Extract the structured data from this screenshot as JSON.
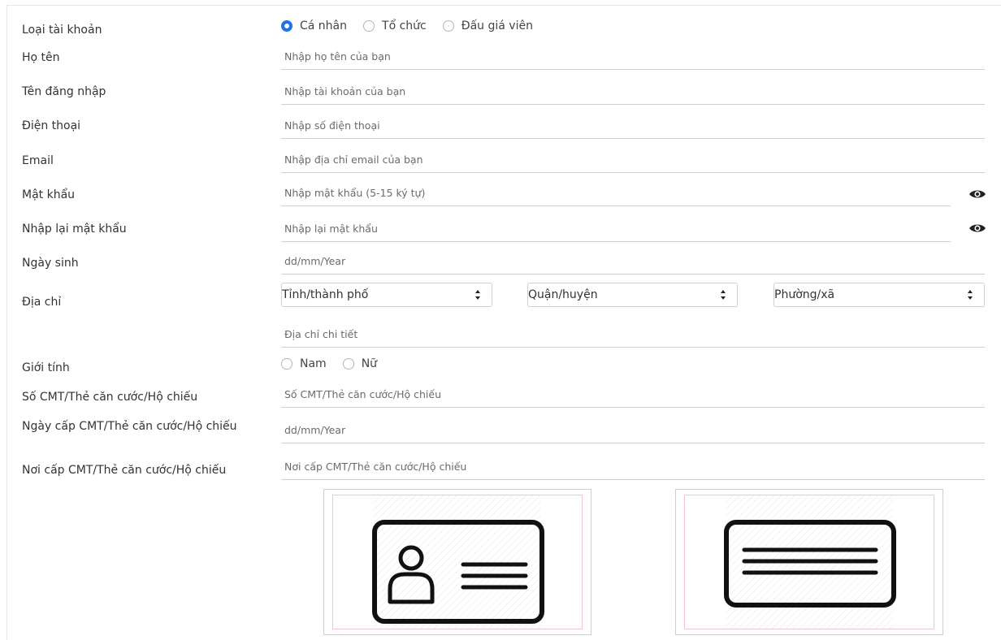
{
  "account_type": {
    "label": "Loại tài khoản",
    "options": [
      {
        "label": "Cá nhân",
        "checked": true
      },
      {
        "label": "Tổ chức",
        "checked": false
      },
      {
        "label": "Đấu giá viên",
        "checked": false
      }
    ]
  },
  "fields": {
    "full_name": {
      "label": "Họ tên",
      "placeholder": "Nhập họ tên của bạn"
    },
    "username": {
      "label": "Tên đăng nhập",
      "placeholder": "Nhập tài khoản của bạn"
    },
    "phone": {
      "label": "Điện thoại",
      "placeholder": "Nhập số điện thoại"
    },
    "email": {
      "label": "Email",
      "placeholder": "Nhập địa chỉ email của bạn"
    },
    "password": {
      "label": "Mật khẩu",
      "placeholder": "Nhập mật khẩu (5-15 ký tự)"
    },
    "confirm_password": {
      "label": "Nhập lại mật khẩu",
      "placeholder": "Nhập lại mật khẩu"
    },
    "birthday": {
      "label": "Ngày sinh",
      "placeholder": "dd/mm/Year"
    },
    "address_detail": {
      "placeholder": "Địa chỉ chi tiết"
    },
    "id_number": {
      "label": "Số CMT/Thẻ căn cước/Hộ chiếu",
      "placeholder": "Số CMT/Thẻ căn cước/Hộ chiếu"
    },
    "id_issue_date": {
      "label": "Ngày cấp CMT/Thẻ căn cước/Hộ chiếu",
      "placeholder": "dd/mm/Year"
    },
    "id_issue_place": {
      "label": "Nơi cấp CMT/Thẻ căn cước/Hộ chiếu",
      "placeholder": "Nơi cấp CMT/Thẻ căn cước/Hộ chiếu"
    }
  },
  "address": {
    "label": "Địa chỉ",
    "province": "Tỉnh/thành phố",
    "district": "Quận/huyện",
    "ward": "Phường/xã"
  },
  "gender": {
    "label": "Giới tính",
    "options": [
      {
        "label": "Nam",
        "checked": false
      },
      {
        "label": "Nữ",
        "checked": false
      }
    ]
  },
  "uploads": {
    "front_icon": "id-card-front-icon",
    "back_icon": "id-card-back-icon"
  },
  "colors": {
    "accent": "#1a73e8"
  }
}
